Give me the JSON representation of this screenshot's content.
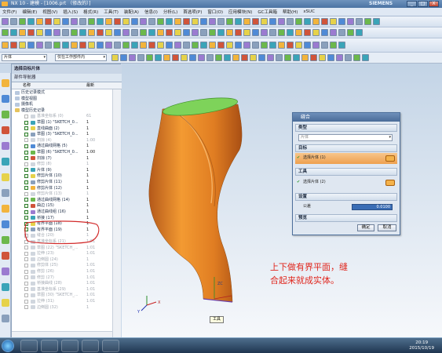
{
  "window": {
    "title": "NX 10 - 建模 - [1006.prt （修改的）]",
    "brand": "SIEMENS",
    "minimize": "_",
    "maximize": "□",
    "close": "X"
  },
  "menu": [
    "文件(F)",
    "编辑(E)",
    "视图(V)",
    "插入(S)",
    "格式(R)",
    "工具(T)",
    "装配(A)",
    "信息(I)",
    "分析(L)",
    "首选项(P)",
    "窗口(O)",
    "应用模块(N)",
    "GC工具箱",
    "帮助(H)",
    "xSUC"
  ],
  "selection_bar": {
    "filter": "片体",
    "scope": "仅在工作部件内"
  },
  "navigator": {
    "header1": "选择目标片体",
    "header2": "部件导航器",
    "col_name": "名称",
    "col_uptodate": "最新",
    "rows": [
      {
        "name": "历史记录模式",
        "ud": "",
        "gray": false
      },
      {
        "name": "模型视图",
        "ud": "",
        "gray": false
      },
      {
        "name": "摄像机",
        "ud": "",
        "gray": false
      },
      {
        "name": "模型历史记录",
        "ud": "",
        "gray": false
      },
      {
        "name": "基准坐标系 (0)",
        "ud": "61",
        "gray": true
      },
      {
        "name": "草图 (1) \"SKETCH_0...",
        "ud": "1",
        "gray": false
      },
      {
        "name": "直线曲面 (2)",
        "ud": "1",
        "gray": false
      },
      {
        "name": "草图 (3) \"SKETCH_0...",
        "ud": "1",
        "gray": false
      },
      {
        "name": "扫掠 (4)",
        "ud": "1:00",
        "gray": true
      },
      {
        "name": "通过曲线网格 (5)",
        "ud": "1",
        "gray": false
      },
      {
        "name": "草图 (6) \"SKETCH_0...",
        "ud": "1:00",
        "gray": false
      },
      {
        "name": "扫掠 (7)",
        "ud": "1",
        "gray": false
      },
      {
        "name": "修剪 (8)",
        "ud": "1",
        "gray": true
      },
      {
        "name": "片体 (9)",
        "ud": "1",
        "gray": false
      },
      {
        "name": "修剪片体 (10)",
        "ud": "1",
        "gray": false
      },
      {
        "name": "修剪片体 (11)",
        "ud": "1",
        "gray": false
      },
      {
        "name": "修剪片体 (12)",
        "ud": "1",
        "gray": false
      },
      {
        "name": "修剪片体 (13)",
        "ud": "1",
        "gray": true
      },
      {
        "name": "通过曲线网格 (14)",
        "ud": "1",
        "gray": false
      },
      {
        "name": "曲边 (15)",
        "ud": "1",
        "gray": false
      },
      {
        "name": "通过曲线组 (16)",
        "ud": "1",
        "gray": false
      },
      {
        "name": "桥接 (17)",
        "ud": "1",
        "gray": false
      },
      {
        "name": "有界平面 (18)",
        "ud": "1",
        "gray": false
      },
      {
        "name": "有界平面 (19)",
        "ud": "1",
        "gray": false
      },
      {
        "name": "缝合 (20)",
        "ud": "1",
        "gray": true
      },
      {
        "name": "基准坐标系 (21)",
        "ud": "1:01",
        "gray": true
      },
      {
        "name": "草图 (22) \"SKETCH_...",
        "ud": "1:01",
        "gray": true
      },
      {
        "name": "拉伸 (23)",
        "ud": "1:01",
        "gray": true
      },
      {
        "name": "边倒圆 (24)",
        "ud": "1",
        "gray": true
      },
      {
        "name": "修剪体 (25)",
        "ud": "1:01",
        "gray": true
      },
      {
        "name": "修剪 (26)",
        "ud": "1:01",
        "gray": true
      },
      {
        "name": "修剪 (27)",
        "ud": "1:01",
        "gray": true
      },
      {
        "name": "桥接曲线 (28)",
        "ud": "1:01",
        "gray": true
      },
      {
        "name": "基准坐标系 (29)",
        "ud": "1:01",
        "gray": true
      },
      {
        "name": "草图 (30) \"SKETCH_...",
        "ud": "1:01",
        "gray": true
      },
      {
        "name": "拉伸 (31)",
        "ud": "1:01",
        "gray": true
      },
      {
        "name": "边倒圆 (32)",
        "ud": "1",
        "gray": true
      }
    ]
  },
  "dialog": {
    "title": "缝合",
    "sec_type": "类型",
    "type_value": "片体",
    "sec_target": "目标",
    "target_value": "选择片体 (1)",
    "sec_tool": "工具",
    "tool_value": "选择片体 (2)",
    "sec_settings": "设置",
    "tolerance_label": "公差",
    "tolerance_value": "0.0100",
    "sec_preview": "预览",
    "ok": "确定",
    "cancel": "取消"
  },
  "annotation": {
    "line1": "上下做有界平面，缝",
    "line2": "合起来就成实体。"
  },
  "tooltip": "工具",
  "axis": {
    "x": "X",
    "y": "Y",
    "z": "ZC"
  },
  "taskbar": {
    "time": "20:19",
    "date": "2015/10/19"
  },
  "colors": {
    "part_orange": "#e98d27",
    "top_face_green": "#7ed35a",
    "title_blue": "#4b73a3",
    "annot_red": "#e0271e",
    "highlight_ring": "#d22a2a"
  }
}
